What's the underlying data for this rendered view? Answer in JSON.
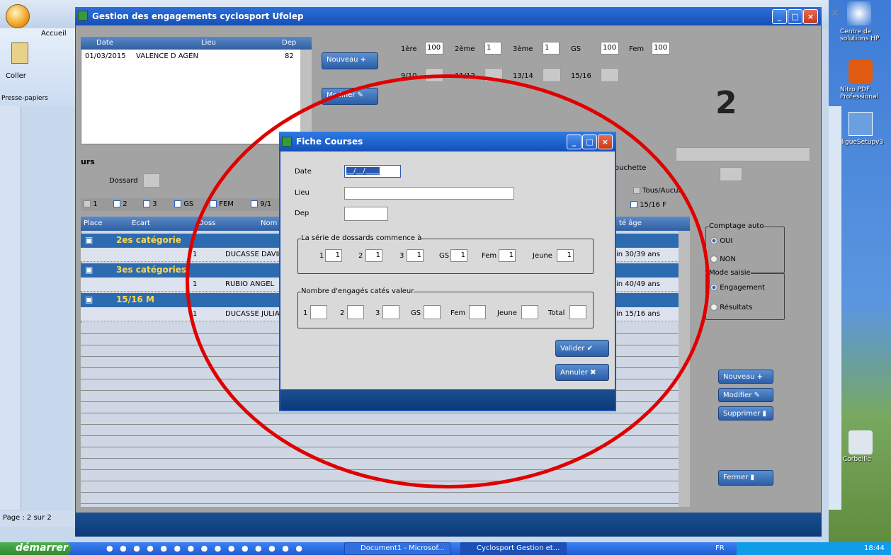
{
  "word": {
    "tab": "Accueil",
    "paste": "Coller",
    "clipboard": "Presse-papiers",
    "status": "Page : 2 sur 2"
  },
  "desktop": {
    "icons": [
      "Centre de solutions HP",
      "Nitro PDF Professional",
      "ligueSetupv3",
      "Corbeille"
    ]
  },
  "app": {
    "title": "Gestion des engagements cyclosport Ufolep",
    "races_header": [
      "Date",
      "Lieu",
      "Dep"
    ],
    "races": [
      {
        "date": "01/03/2015",
        "lieu": "VALENCE D AGEN",
        "dep": "82"
      }
    ],
    "new_btn": "Nouveau",
    "modify_btn": "Modifier",
    "cats": [
      {
        "label": "1ère",
        "value": "100"
      },
      {
        "label": "2ème",
        "value": "1"
      },
      {
        "label": "3ème",
        "value": "1"
      },
      {
        "label": "GS",
        "value": "100"
      },
      {
        "label": "Fem",
        "value": "100"
      }
    ],
    "cats2": [
      "9/10",
      "11/12",
      "13/14",
      "15/16"
    ],
    "big_number": "2",
    "urs": "urs",
    "dossard": "Dossard",
    "bouchette": "ouchette",
    "tous": "Tous/Aucun",
    "filters": [
      "1",
      "2",
      "3",
      "GS",
      "FEM",
      "9/1"
    ],
    "filter_right": "15/16 F",
    "list_header": [
      "Place",
      "Ecart",
      "Doss",
      "Nom",
      "té âge"
    ],
    "groups": [
      {
        "name": "2es catégorie",
        "rows": [
          {
            "doss": "1",
            "nom": "DUCASSE DAVID",
            "age": "in 30/39 ans"
          }
        ]
      },
      {
        "name": "3es catégories",
        "rows": [
          {
            "doss": "1",
            "nom": "RUBIO ANGEL",
            "age": "in 40/49 ans"
          }
        ]
      },
      {
        "name": "15/16 M",
        "rows": [
          {
            "doss": "1",
            "nom": "DUCASSE JULIAN",
            "age": "in 15/16 ans"
          }
        ]
      }
    ],
    "comptage": {
      "title": "Comptage auto",
      "oui": "OUI",
      "non": "NON"
    },
    "mode": {
      "title": "Mode saisie",
      "eng": "Engagement",
      "res": "Résultats"
    },
    "right_btns": {
      "new": "Nouveau",
      "mod": "Modifier",
      "del": "Supprimer",
      "close": "Fermer"
    }
  },
  "dialog": {
    "title": "Fiche Courses",
    "date_label": "Date",
    "date_value": "__/__/____",
    "lieu_label": "Lieu",
    "dep_label": "Dep",
    "serie_title": "La série de dossards commence à",
    "serie": [
      {
        "l": "1",
        "v": "1"
      },
      {
        "l": "2",
        "v": "1"
      },
      {
        "l": "3",
        "v": "1"
      },
      {
        "l": "GS",
        "v": "1"
      },
      {
        "l": "Fem",
        "v": "1"
      },
      {
        "l": "Jeune",
        "v": "1"
      }
    ],
    "nb_title": "Nombre d'engagés catés valeur",
    "nb": [
      "1",
      "2",
      "3",
      "GS",
      "Fem",
      "Jeune",
      "Total"
    ],
    "validate": "Valider",
    "cancel": "Annuler"
  },
  "taskbar": {
    "start": "démarrer",
    "tasks": [
      "Document1 - Microsof...",
      "Cyclosport Gestion et..."
    ],
    "lang": "FR",
    "time": "18:44"
  }
}
